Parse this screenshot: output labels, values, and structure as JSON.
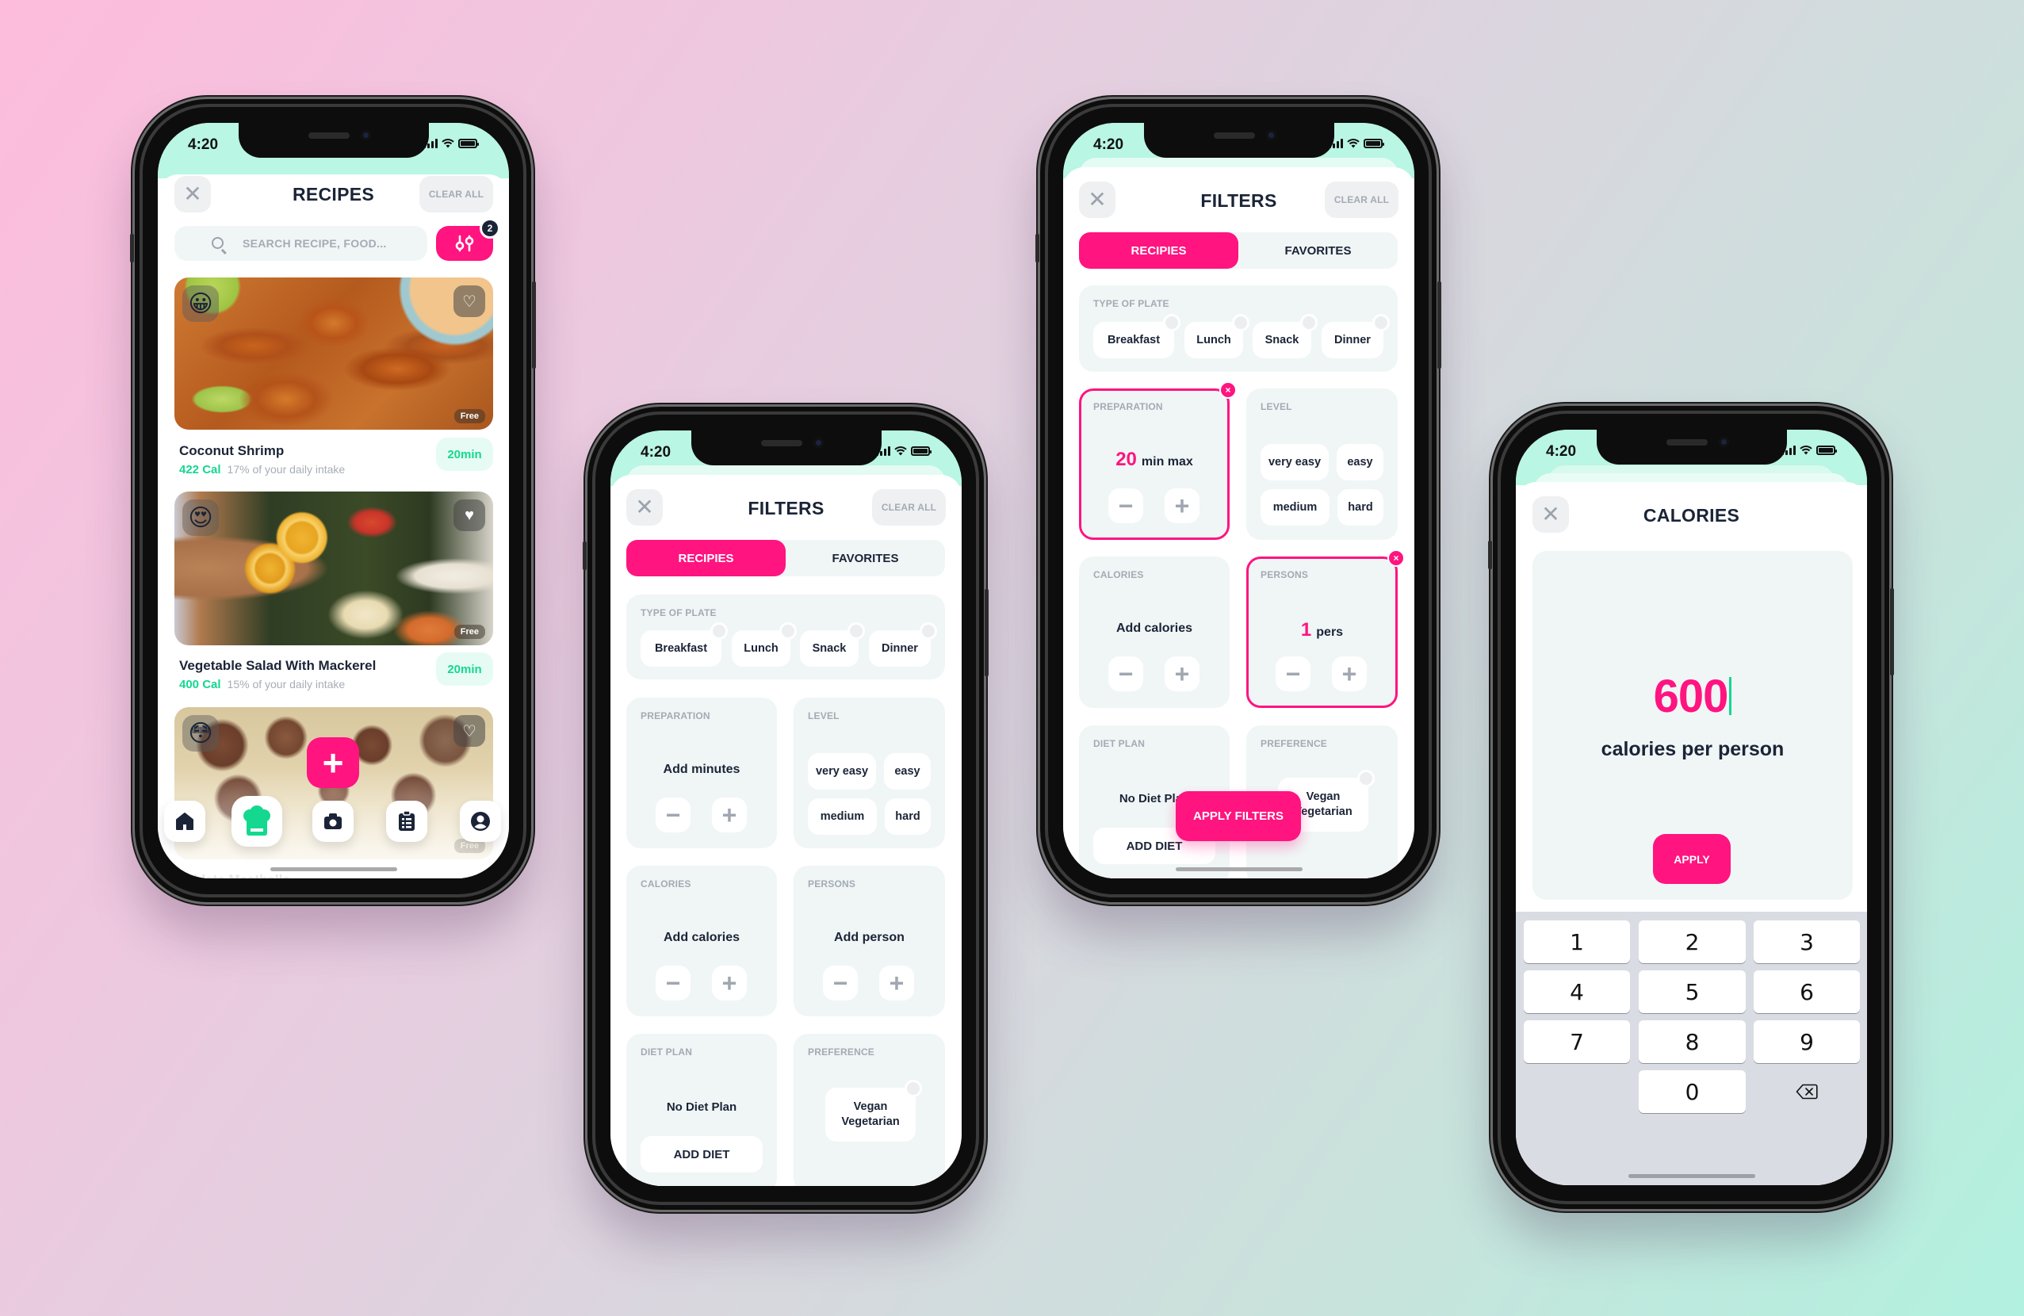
{
  "colors": {
    "accent": "#ff1480",
    "mint": "#b9f6e3",
    "green": "#14d88f",
    "text_dark": "#1b2437",
    "panel": "#f0f6f6"
  },
  "status_bar": {
    "time": "4:20"
  },
  "recipes_screen": {
    "title": "RECIPES",
    "close_icon": "close-icon",
    "clear_all": "CLEAR ALL",
    "search_placeholder": "SEARCH RECIPE, FOOD...",
    "filter_badge": "2",
    "recipes": [
      {
        "name": "Coconut Shrimp",
        "calories": "422 Cal",
        "intake": "17% of your daily intake",
        "time": "20min",
        "tag": "Free",
        "emoji": "😀",
        "favorite": false
      },
      {
        "name": "Vegetable Salad With Mackerel",
        "calories": "400 Cal",
        "intake": "15% of your daily intake",
        "time": "20min",
        "tag": "Free",
        "emoji": "😍",
        "favorite": true
      },
      {
        "name": "Athlete Meatballs",
        "tag": "Free",
        "emoji": "😳",
        "favorite": false
      }
    ],
    "fab_label": "+",
    "tab_bar": [
      {
        "name": "home",
        "icon": "home-icon",
        "active": false
      },
      {
        "name": "recipes",
        "icon": "chef-hat-icon",
        "active": true
      },
      {
        "name": "camera",
        "icon": "camera-icon",
        "active": false
      },
      {
        "name": "list",
        "icon": "clipboard-list-icon",
        "active": false
      },
      {
        "name": "profile",
        "icon": "user-icon",
        "active": false
      }
    ]
  },
  "filters_screen_empty": {
    "title": "FILTERS",
    "clear_all": "CLEAR ALL",
    "tabs": [
      {
        "label": "RECIPIES",
        "active": true
      },
      {
        "label": "FAVORITES",
        "active": false
      }
    ],
    "type_of_plate": {
      "label": "TYPE OF PLATE",
      "options": [
        "Breakfast",
        "Lunch",
        "Snack",
        "Dinner"
      ]
    },
    "preparation": {
      "label": "PREPARATION",
      "value": "Add minutes"
    },
    "level": {
      "label": "LEVEL",
      "options": [
        "very easy",
        "easy",
        "medium",
        "hard"
      ]
    },
    "calories": {
      "label": "CALORIES",
      "value": "Add calories"
    },
    "persons": {
      "label": "PERSONS",
      "value": "Add person"
    },
    "diet_plan": {
      "label": "DIET PLAN",
      "value": "No Diet Plan",
      "button": "ADD DIET"
    },
    "preference": {
      "label": "PREFERENCE",
      "option_line1": "Vegan",
      "option_line2": "Vegetarian"
    },
    "minus": "−",
    "plus": "+"
  },
  "filters_screen_set": {
    "title": "FILTERS",
    "clear_all": "CLEAR ALL",
    "tabs": [
      {
        "label": "RECIPIES",
        "active": true
      },
      {
        "label": "FAVORITES",
        "active": false
      }
    ],
    "type_of_plate": {
      "label": "TYPE OF PLATE",
      "options": [
        "Breakfast",
        "Lunch",
        "Snack",
        "Dinner"
      ]
    },
    "preparation": {
      "label": "PREPARATION",
      "number": "20",
      "unit": "min max",
      "selected": true
    },
    "level": {
      "label": "LEVEL",
      "options": [
        "very easy",
        "easy",
        "medium",
        "hard"
      ]
    },
    "calories": {
      "label": "CALORIES",
      "value": "Add calories"
    },
    "persons": {
      "label": "PERSONS",
      "number": "1",
      "unit": "pers",
      "selected": true
    },
    "diet_plan": {
      "label": "DIET PLAN",
      "value": "No Diet Plan",
      "button": "ADD DIET"
    },
    "preference": {
      "label": "PREFERENCE",
      "option_line1": "Vegan",
      "option_line2": "Vegetarian"
    },
    "apply_button": "APPLY FILTERS",
    "remove_icon": "×",
    "minus": "−",
    "plus": "+"
  },
  "calories_screen": {
    "title": "CALORIES",
    "value": "600",
    "unit_label": "calories per person",
    "apply_button": "APPLY",
    "keypad": [
      "1",
      "2",
      "3",
      "4",
      "5",
      "6",
      "7",
      "8",
      "9",
      "0"
    ],
    "backspace_icon": "backspace-icon"
  }
}
